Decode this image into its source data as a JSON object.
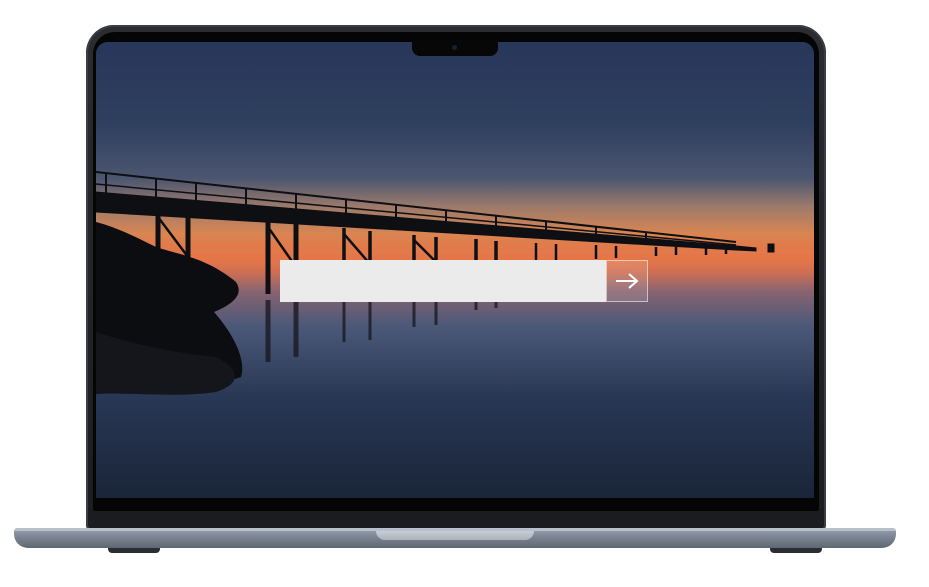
{
  "device": {
    "name": "laptop"
  },
  "wallpaper": {
    "scene": "pier-at-sunset",
    "sky_top": "#2b3b55",
    "horizon": "#e0764a",
    "water": "#1f2c42"
  },
  "url_bar": {
    "value": "",
    "placeholder": ""
  },
  "go_button": {
    "icon": "arrow-right-icon"
  }
}
